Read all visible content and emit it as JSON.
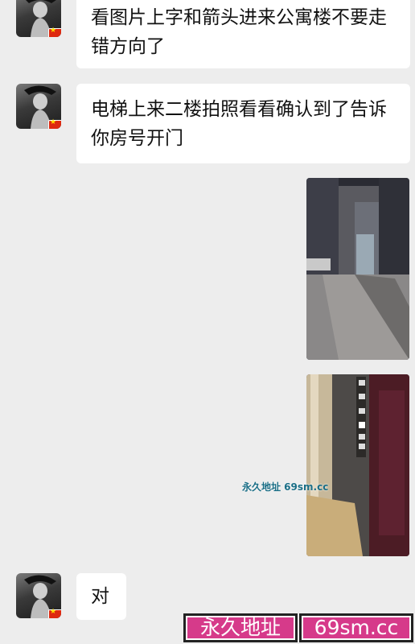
{
  "messages": {
    "msg1": {
      "text": "看图片上字和箭头进来公寓楼不要走错方向了"
    },
    "msg2": {
      "text": "电梯上来二楼拍照看看确认到了告诉你房号开门"
    },
    "msg3": {
      "text": "对"
    }
  },
  "photos": {
    "photo1": {
      "description_icon": "street-photo"
    },
    "photo2": {
      "description_icon": "elevator-photo",
      "floor_buttons": [
        "6",
        "4",
        "3",
        "2",
        "1",
        "-1"
      ]
    }
  },
  "watermark": {
    "text": "永久地址 69sm.cc"
  },
  "banner": {
    "left_label": "永久地址",
    "right_label": "69sm.cc"
  },
  "colors": {
    "background": "#ededed",
    "bubble": "#ffffff",
    "banner": "#d63a8a"
  }
}
